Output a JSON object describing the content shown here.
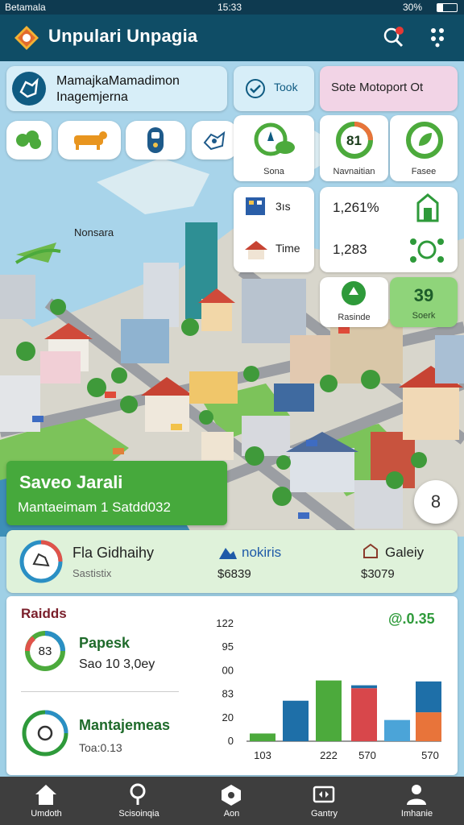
{
  "status_bar": {
    "carrier": "Betamala",
    "time": "15:33",
    "battery": "30%"
  },
  "app_bar": {
    "title": "Unpulari Unpagia"
  },
  "map": {
    "place_label": "Nonsara"
  },
  "info_card": {
    "line1": "MamajkaMamadimon",
    "line2": "Inagemjerna"
  },
  "chips": {
    "took_label": "Took",
    "report_label": "Sote Motoport Ot"
  },
  "stats": {
    "tile1_label": "Sona",
    "tile2_value": "81",
    "tile2_label": "Navnaitian",
    "tile3_label": "Fasee",
    "row1_value": "3ıs",
    "row1_pct": "1,261%",
    "row2_value": "Time",
    "row2_count": "1,283",
    "tile4_label": "Rasinde",
    "tile5_value": "39",
    "tile5_label": "Soerk"
  },
  "banner": {
    "title": "Saveo Jarali",
    "subtitle": "Mantaeimam 1 Satdd032"
  },
  "fab": {
    "value": "8"
  },
  "summary": {
    "item1_title": "Fla Gidhaihy",
    "item1_sub": "Sastistix",
    "item2_title": "nokiris",
    "item2_value": "$6839",
    "item3_title": "Galeiy",
    "item3_value": "$3079"
  },
  "panel": {
    "heading": "Raidds",
    "row1_title": "Papesk",
    "row1_sub": "Sao 10 3,0ey",
    "row1_badge": "83",
    "row2_title": "Mantajemeas",
    "row2_sub": "Toa:0.13",
    "total": "@.0.35"
  },
  "colors": {
    "green": "#4caa3c",
    "blue": "#1e6fa8",
    "red": "#d8474b",
    "sky": "#4ba4d8",
    "orange": "#e8743a",
    "navy": "#0f4d66"
  },
  "chart_data": {
    "type": "bar",
    "y_ticks": [
      "122",
      "95",
      "00",
      "83",
      "20",
      "0"
    ],
    "x_tick_labels": [
      "103",
      "222",
      "570",
      "570"
    ],
    "ylim": [
      0,
      122
    ],
    "bars": [
      {
        "group": "103",
        "color": "green",
        "value": 8
      },
      {
        "group": "103",
        "color": "blue",
        "value": 42
      },
      {
        "group": "222",
        "color": "green",
        "value": 63
      },
      {
        "group": "570",
        "color": "red",
        "value": 55
      },
      {
        "group": "570",
        "color": "blue",
        "value": 3
      },
      {
        "group": "570",
        "color": "sky",
        "value": 22
      },
      {
        "group": "570",
        "color": "orange",
        "value": 30
      },
      {
        "group": "570",
        "color": "blue",
        "value": 32
      }
    ]
  },
  "nav": [
    {
      "label": "Umdoth",
      "icon": "home-icon"
    },
    {
      "label": "Scisoinqia",
      "icon": "person-search-icon"
    },
    {
      "label": "Aon",
      "icon": "hexagon-icon"
    },
    {
      "label": "Gantry",
      "icon": "dashboard-icon"
    },
    {
      "label": "Imhanie",
      "icon": "profile-icon"
    }
  ]
}
